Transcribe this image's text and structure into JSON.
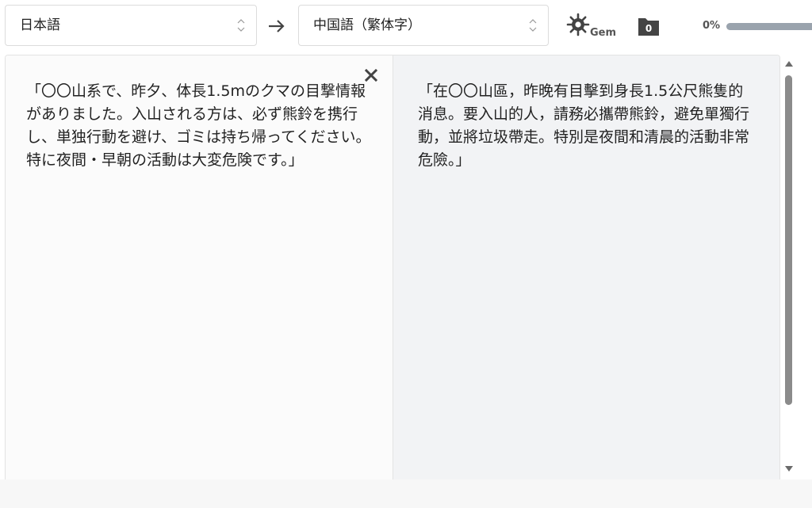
{
  "toolbar": {
    "source_language": "日本語",
    "target_language": "中国語（繁体字）",
    "gem_label": "Gem",
    "folder_count": "0",
    "progress_text": "0%",
    "progress_value": 0
  },
  "icons": {
    "swap": "arrow-right-icon",
    "gem": "gear-icon",
    "folder": "folder-icon",
    "clear": "close-icon",
    "select_caret": "chevron-up-down-icon"
  },
  "source_panel": {
    "text": "「〇〇山系で、昨夕、体長1.5mのクマの目撃情報がありました。入山される方は、必ず熊鈴を携行し、単独行動を避け、ゴミは持ち帰ってください。特に夜間・早朝の活動は大変危険です。」"
  },
  "target_panel": {
    "text": "「在〇〇山區，昨晚有目擊到身長1.5公尺熊隻的消息。要入山的人，請務必攜帶熊鈴，避免單獨行動，並將垃圾帶走。特別是夜間和清晨的活動非常危險。」"
  },
  "colors": {
    "source_bg": "#fbfbfb",
    "target_bg": "#f2f3f5",
    "border": "#dcdcdc",
    "icon_dark": "#444444",
    "progress_track": "#9aa3ad",
    "scroll_thumb": "#8b8b8b"
  }
}
